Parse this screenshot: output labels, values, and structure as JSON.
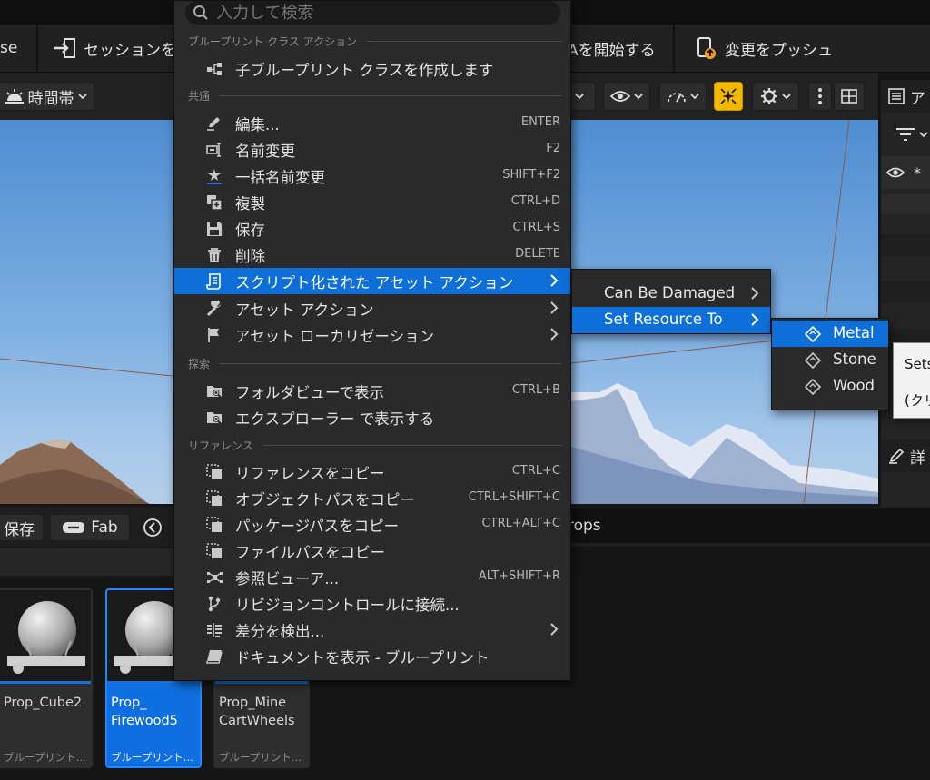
{
  "search": {
    "placeholder": "入力して検索"
  },
  "toolbar": {
    "left_label": "se",
    "session_label": "セッションを終",
    "start_label": "Aを開始する",
    "push_label": "変更をプッシュ"
  },
  "viewport": {
    "time_label": "時間帯"
  },
  "right_panel": {
    "top_char": "ア",
    "detail_char": "詳"
  },
  "content_browser": {
    "save_label": "保存",
    "fab_label": "Fab",
    "path_text": "rops",
    "tiles": [
      {
        "name": "Prop_Cube2",
        "type": "ブループリント..."
      },
      {
        "name": "Prop_\nFirewood5",
        "type": "ブループリント..."
      },
      {
        "name": "Prop_Mine\nCartWheels",
        "type": "ブループリント..."
      }
    ]
  },
  "context_menu": {
    "sections": {
      "blueprint_class": "ブループリント クラス アクション",
      "common": "共通",
      "explore": "探索",
      "references": "リファレンス"
    },
    "items": {
      "create_child": {
        "label": "子ブループリント クラスを作成します",
        "shortcut": ""
      },
      "edit": {
        "label": "編集...",
        "shortcut": "ENTER"
      },
      "rename": {
        "label": "名前変更",
        "shortcut": "F2"
      },
      "bulk_rename": {
        "label": "一括名前変更",
        "shortcut": "SHIFT+F2"
      },
      "duplicate": {
        "label": "複製",
        "shortcut": "CTRL+D"
      },
      "save": {
        "label": "保存",
        "shortcut": "CTRL+S"
      },
      "delete": {
        "label": "削除",
        "shortcut": "DELETE"
      },
      "scripted_actions": {
        "label": "スクリプト化された アセット アクション",
        "shortcut": ""
      },
      "asset_actions": {
        "label": "アセット アクション",
        "shortcut": ""
      },
      "localization": {
        "label": "アセット ローカリゼーション",
        "shortcut": ""
      },
      "show_in_folder": {
        "label": "フォルダビューで表示",
        "shortcut": "CTRL+B"
      },
      "show_in_explorer": {
        "label": "エクスプローラー で表示する",
        "shortcut": ""
      },
      "copy_reference": {
        "label": "リファレンスをコピー",
        "shortcut": "CTRL+C"
      },
      "copy_object_path": {
        "label": "オブジェクトパスをコピー",
        "shortcut": "CTRL+SHIFT+C"
      },
      "copy_package_path": {
        "label": "パッケージパスをコピー",
        "shortcut": "CTRL+ALT+C"
      },
      "copy_file_path": {
        "label": "ファイルパスをコピー",
        "shortcut": ""
      },
      "reference_viewer": {
        "label": "参照ビューア...",
        "shortcut": "ALT+SHIFT+R"
      },
      "source_control": {
        "label": "リビジョンコントロールに接続...",
        "shortcut": ""
      },
      "diff": {
        "label": "差分を検出...",
        "shortcut": ""
      },
      "documentation": {
        "label": "ドキュメントを表示 - ブループリント",
        "shortcut": ""
      }
    }
  },
  "submenu_scripted": {
    "can_be_damaged": "Can Be Damaged",
    "set_resource_to": "Set Resource To"
  },
  "submenu_resource": {
    "metal": "Metal",
    "stone": "Stone",
    "wood": "Wood"
  },
  "tooltip": {
    "line1": "Sets",
    "line2": "(クリ"
  },
  "colors": {
    "highlight": "#0f6fd9",
    "menu_bg": "#2a2a2a",
    "accent_yellow": "#f5b800"
  }
}
